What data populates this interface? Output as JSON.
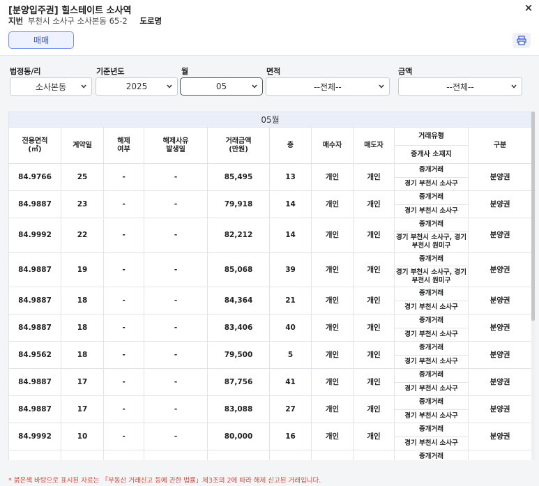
{
  "header": {
    "title": "[분양입주권] 힐스테이트 소사역",
    "address_label": "지번",
    "address_value": "부천시 소사구 소사본동 65-2",
    "road_label": "도로명",
    "tab_label": "매매",
    "close": "×"
  },
  "filters": {
    "dong_label": "법정동/리",
    "dong_value": "소사본동",
    "year_label": "기준년도",
    "year_value": "2025",
    "month_label": "월",
    "month_value": "05",
    "area_label": "면적",
    "area_value": "--전체--",
    "price_label": "금액",
    "price_value": "--전체--"
  },
  "table": {
    "month_title": "05월",
    "headers": {
      "area": "전용면적\n(㎡)",
      "day": "계약일",
      "cancel": "해제\n여부",
      "cancel_date": "해제사유\n발생일",
      "price": "거래금액\n(만원)",
      "floor": "층",
      "buyer": "매수자",
      "seller": "매도자",
      "deal_type": "거래유형",
      "broker_loc": "중개사 소재지",
      "category": "구분"
    },
    "rows": [
      {
        "area": "84.9766",
        "day": "25",
        "cancel": "-",
        "cancel_date": "-",
        "price": "85,495",
        "floor": "13",
        "buyer": "개인",
        "seller": "개인",
        "deal_type": "중개거래",
        "broker_loc": "경기 부천시 소사구",
        "category": "분양권"
      },
      {
        "area": "84.9887",
        "day": "23",
        "cancel": "-",
        "cancel_date": "-",
        "price": "79,918",
        "floor": "14",
        "buyer": "개인",
        "seller": "개인",
        "deal_type": "중개거래",
        "broker_loc": "경기 부천시 소사구",
        "category": "분양권"
      },
      {
        "area": "84.9992",
        "day": "22",
        "cancel": "-",
        "cancel_date": "-",
        "price": "82,212",
        "floor": "14",
        "buyer": "개인",
        "seller": "개인",
        "deal_type": "중개거래",
        "broker_loc": "경기 부천시 소사구, 경기 부천시 원미구",
        "category": "분양권"
      },
      {
        "area": "84.9887",
        "day": "19",
        "cancel": "-",
        "cancel_date": "-",
        "price": "85,068",
        "floor": "39",
        "buyer": "개인",
        "seller": "개인",
        "deal_type": "중개거래",
        "broker_loc": "경기 부천시 소사구, 경기 부천시 원미구",
        "category": "분양권"
      },
      {
        "area": "84.9887",
        "day": "18",
        "cancel": "-",
        "cancel_date": "-",
        "price": "84,364",
        "floor": "21",
        "buyer": "개인",
        "seller": "개인",
        "deal_type": "중개거래",
        "broker_loc": "경기 부천시 소사구",
        "category": "분양권"
      },
      {
        "area": "84.9887",
        "day": "18",
        "cancel": "-",
        "cancel_date": "-",
        "price": "83,406",
        "floor": "40",
        "buyer": "개인",
        "seller": "개인",
        "deal_type": "중개거래",
        "broker_loc": "경기 부천시 소사구",
        "category": "분양권"
      },
      {
        "area": "84.9562",
        "day": "18",
        "cancel": "-",
        "cancel_date": "-",
        "price": "79,500",
        "floor": "5",
        "buyer": "개인",
        "seller": "개인",
        "deal_type": "중개거래",
        "broker_loc": "경기 부천시 소사구",
        "category": "분양권"
      },
      {
        "area": "84.9887",
        "day": "17",
        "cancel": "-",
        "cancel_date": "-",
        "price": "87,756",
        "floor": "41",
        "buyer": "개인",
        "seller": "개인",
        "deal_type": "중개거래",
        "broker_loc": "경기 부천시 소사구",
        "category": "분양권"
      },
      {
        "area": "84.9887",
        "day": "17",
        "cancel": "-",
        "cancel_date": "-",
        "price": "83,088",
        "floor": "27",
        "buyer": "개인",
        "seller": "개인",
        "deal_type": "중개거래",
        "broker_loc": "경기 부천시 소사구",
        "category": "분양권"
      },
      {
        "area": "84.9992",
        "day": "10",
        "cancel": "-",
        "cancel_date": "-",
        "price": "80,000",
        "floor": "16",
        "buyer": "개인",
        "seller": "개인",
        "deal_type": "중개거래",
        "broker_loc": "경기 부천시 소사구",
        "category": "분양권"
      },
      {
        "area": "",
        "day": "",
        "cancel": "",
        "cancel_date": "",
        "price": "",
        "floor": "",
        "buyer": "",
        "seller": "",
        "deal_type": "중개거래",
        "broker_loc": "",
        "category": ""
      }
    ]
  },
  "footnote": "* 붉은색 바탕으로 표시된 자료는 「부동산 거래신고 등에 관한 법률」제3조의 2에 따라 해제 신고된 거래입니다.",
  "icons": {
    "close": "close-icon",
    "print": "printer-icon",
    "chevron": "chevron-down-icon"
  },
  "colors": {
    "accent": "#3a55d6",
    "tab_bg": "#eef1ff",
    "header_row_bg": "#e9eef8",
    "footnote": "#e2463c"
  }
}
